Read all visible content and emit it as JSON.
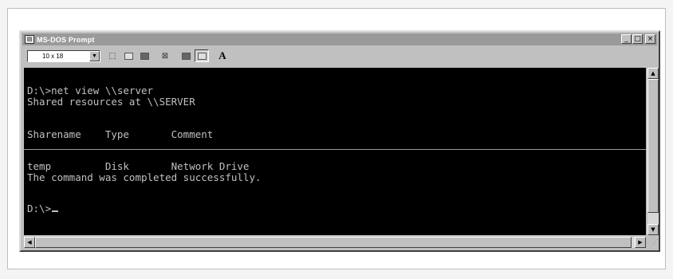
{
  "window": {
    "title": "MS-DOS Prompt",
    "buttons": {
      "minimize": "_",
      "maximize": "□",
      "close": "×"
    }
  },
  "toolbar": {
    "font_size": "10 x 18",
    "font_button": "A"
  },
  "console": {
    "lines": [
      "D:\\>net view \\\\server",
      "Shared resources at \\\\SERVER",
      "Sharename    Type       Comment",
      "temp         Disk       Network Drive",
      "The command was completed successfully.",
      "D:\\>"
    ]
  },
  "colors": {
    "console_bg": "#000000",
    "console_text": "#c0c0c0",
    "titlebar": "#9a9a9a"
  },
  "icons": [
    "msdos-icon",
    "dropdown-arrow-icon",
    "mark-icon",
    "copy-icon",
    "paste-icon",
    "fullscreen-icon",
    "properties-icon",
    "background-icon",
    "font-icon"
  ]
}
